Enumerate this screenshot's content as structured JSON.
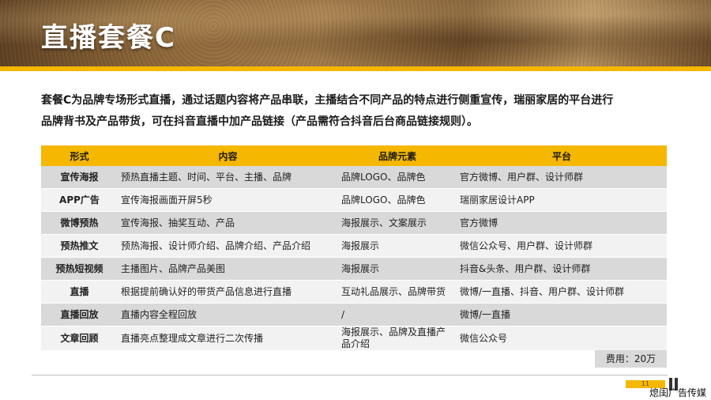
{
  "header": {
    "title": "直播套餐C"
  },
  "intro": {
    "line1": "套餐C为品牌专场形式直播，通过话题内容将产品串联，主播结合不同产品的特点进行侧重宣传，瑞丽家居的平台进行",
    "line2": "品牌背书及产品带货，可在抖音直播中加产品链接（产品需符合抖音后台商品链接规则）。"
  },
  "table": {
    "headers": [
      "形式",
      "内容",
      "品牌元素",
      "平台"
    ],
    "rows": [
      {
        "form": "宣传海报",
        "content": "预热直播主题、时间、平台、主播、品牌",
        "brand": "品牌LOGO、品牌色",
        "platform": "官方微博、用户群、设计师群"
      },
      {
        "form": "APP广告",
        "content": "宣传海报画面开屏5秒",
        "brand": "品牌LOGO、品牌色",
        "platform": "瑞丽家居设计APP"
      },
      {
        "form": "微博预热",
        "content": "宣传海报、抽奖互动、产品",
        "brand": "海报展示、文案展示",
        "platform": "官方微博"
      },
      {
        "form": "预热推文",
        "content": "预热海报、设计师介绍、品牌介绍、产品介绍",
        "brand": "海报展示",
        "platform": "微信公众号、用户群、设计师群"
      },
      {
        "form": "预热短视频",
        "content": "主播图片、品牌产品美图",
        "brand": "海报展示",
        "platform": "抖音&头条、用户群、设计师群"
      },
      {
        "form": "直播",
        "content": "根据提前确认好的带货产品信息进行直播",
        "brand": "互动礼品展示、品牌带货",
        "platform": "微博/一直播、抖音、用户群、设计师群"
      },
      {
        "form": "直播回放",
        "content": "直播内容全程回放",
        "brand": "/",
        "platform": "微博/一直播"
      },
      {
        "form": "文章回顾",
        "content": "直播亮点整理成文章进行二次传播",
        "brand": "海报展示、品牌及直播产品介绍",
        "platform": "微信公众号"
      }
    ]
  },
  "fee": "费用：20万",
  "footer": {
    "page_number": "11",
    "watermark": "熄闺广告传媒"
  },
  "colors": {
    "accent": "#f5b700",
    "row_dark": "#d9d9d9",
    "row_light": "#f2f2f2"
  }
}
